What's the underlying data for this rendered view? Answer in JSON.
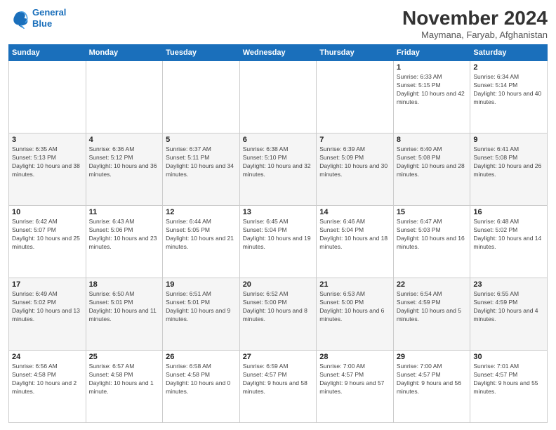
{
  "header": {
    "logo_line1": "General",
    "logo_line2": "Blue",
    "title": "November 2024",
    "location": "Maymana, Faryab, Afghanistan"
  },
  "weekdays": [
    "Sunday",
    "Monday",
    "Tuesday",
    "Wednesday",
    "Thursday",
    "Friday",
    "Saturday"
  ],
  "weeks": [
    [
      {
        "day": "",
        "info": ""
      },
      {
        "day": "",
        "info": ""
      },
      {
        "day": "",
        "info": ""
      },
      {
        "day": "",
        "info": ""
      },
      {
        "day": "",
        "info": ""
      },
      {
        "day": "1",
        "info": "Sunrise: 6:33 AM\nSunset: 5:15 PM\nDaylight: 10 hours and 42 minutes."
      },
      {
        "day": "2",
        "info": "Sunrise: 6:34 AM\nSunset: 5:14 PM\nDaylight: 10 hours and 40 minutes."
      }
    ],
    [
      {
        "day": "3",
        "info": "Sunrise: 6:35 AM\nSunset: 5:13 PM\nDaylight: 10 hours and 38 minutes."
      },
      {
        "day": "4",
        "info": "Sunrise: 6:36 AM\nSunset: 5:12 PM\nDaylight: 10 hours and 36 minutes."
      },
      {
        "day": "5",
        "info": "Sunrise: 6:37 AM\nSunset: 5:11 PM\nDaylight: 10 hours and 34 minutes."
      },
      {
        "day": "6",
        "info": "Sunrise: 6:38 AM\nSunset: 5:10 PM\nDaylight: 10 hours and 32 minutes."
      },
      {
        "day": "7",
        "info": "Sunrise: 6:39 AM\nSunset: 5:09 PM\nDaylight: 10 hours and 30 minutes."
      },
      {
        "day": "8",
        "info": "Sunrise: 6:40 AM\nSunset: 5:08 PM\nDaylight: 10 hours and 28 minutes."
      },
      {
        "day": "9",
        "info": "Sunrise: 6:41 AM\nSunset: 5:08 PM\nDaylight: 10 hours and 26 minutes."
      }
    ],
    [
      {
        "day": "10",
        "info": "Sunrise: 6:42 AM\nSunset: 5:07 PM\nDaylight: 10 hours and 25 minutes."
      },
      {
        "day": "11",
        "info": "Sunrise: 6:43 AM\nSunset: 5:06 PM\nDaylight: 10 hours and 23 minutes."
      },
      {
        "day": "12",
        "info": "Sunrise: 6:44 AM\nSunset: 5:05 PM\nDaylight: 10 hours and 21 minutes."
      },
      {
        "day": "13",
        "info": "Sunrise: 6:45 AM\nSunset: 5:04 PM\nDaylight: 10 hours and 19 minutes."
      },
      {
        "day": "14",
        "info": "Sunrise: 6:46 AM\nSunset: 5:04 PM\nDaylight: 10 hours and 18 minutes."
      },
      {
        "day": "15",
        "info": "Sunrise: 6:47 AM\nSunset: 5:03 PM\nDaylight: 10 hours and 16 minutes."
      },
      {
        "day": "16",
        "info": "Sunrise: 6:48 AM\nSunset: 5:02 PM\nDaylight: 10 hours and 14 minutes."
      }
    ],
    [
      {
        "day": "17",
        "info": "Sunrise: 6:49 AM\nSunset: 5:02 PM\nDaylight: 10 hours and 13 minutes."
      },
      {
        "day": "18",
        "info": "Sunrise: 6:50 AM\nSunset: 5:01 PM\nDaylight: 10 hours and 11 minutes."
      },
      {
        "day": "19",
        "info": "Sunrise: 6:51 AM\nSunset: 5:01 PM\nDaylight: 10 hours and 9 minutes."
      },
      {
        "day": "20",
        "info": "Sunrise: 6:52 AM\nSunset: 5:00 PM\nDaylight: 10 hours and 8 minutes."
      },
      {
        "day": "21",
        "info": "Sunrise: 6:53 AM\nSunset: 5:00 PM\nDaylight: 10 hours and 6 minutes."
      },
      {
        "day": "22",
        "info": "Sunrise: 6:54 AM\nSunset: 4:59 PM\nDaylight: 10 hours and 5 minutes."
      },
      {
        "day": "23",
        "info": "Sunrise: 6:55 AM\nSunset: 4:59 PM\nDaylight: 10 hours and 4 minutes."
      }
    ],
    [
      {
        "day": "24",
        "info": "Sunrise: 6:56 AM\nSunset: 4:58 PM\nDaylight: 10 hours and 2 minutes."
      },
      {
        "day": "25",
        "info": "Sunrise: 6:57 AM\nSunset: 4:58 PM\nDaylight: 10 hours and 1 minute."
      },
      {
        "day": "26",
        "info": "Sunrise: 6:58 AM\nSunset: 4:58 PM\nDaylight: 10 hours and 0 minutes."
      },
      {
        "day": "27",
        "info": "Sunrise: 6:59 AM\nSunset: 4:57 PM\nDaylight: 9 hours and 58 minutes."
      },
      {
        "day": "28",
        "info": "Sunrise: 7:00 AM\nSunset: 4:57 PM\nDaylight: 9 hours and 57 minutes."
      },
      {
        "day": "29",
        "info": "Sunrise: 7:00 AM\nSunset: 4:57 PM\nDaylight: 9 hours and 56 minutes."
      },
      {
        "day": "30",
        "info": "Sunrise: 7:01 AM\nSunset: 4:57 PM\nDaylight: 9 hours and 55 minutes."
      }
    ]
  ]
}
